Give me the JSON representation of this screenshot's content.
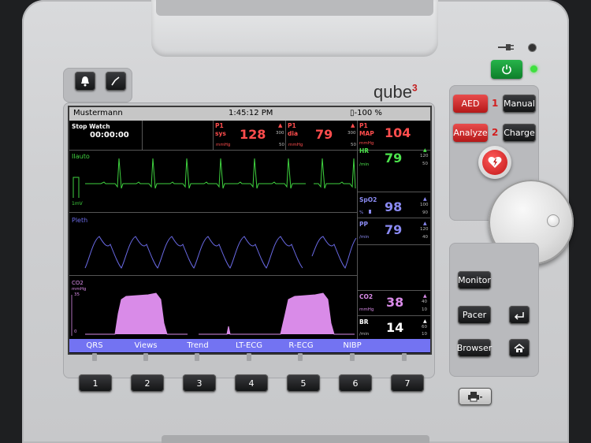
{
  "device": {
    "brand": "qube",
    "brand_sup": "3"
  },
  "screen": {
    "patient_name": "Mustermann",
    "clock": "1:45:12 PM",
    "battery": "-100 %",
    "stopwatch": {
      "label": "Stop Watch",
      "value": "00:00:00"
    },
    "nibp_sys": {
      "label": "P1",
      "sub": "sys",
      "value": "128",
      "upper": "300",
      "lower": "50",
      "unit": "mmHg"
    },
    "nibp_dia": {
      "label": "P1",
      "sub": "dia",
      "value": "79",
      "upper": "300",
      "lower": "50",
      "unit": "mmHg"
    },
    "nibp_map": {
      "label": "P1",
      "sub": "MAP",
      "value": "104",
      "unit": "mmHg"
    },
    "hr": {
      "label": "HR",
      "value": "79",
      "upper": "120",
      "lower": "50",
      "unit": "/min"
    },
    "spo2": {
      "label": "SpO2",
      "value": "98",
      "upper": "100",
      "lower": "90",
      "unit": "%"
    },
    "pp": {
      "label": "PP",
      "value": "79",
      "upper": "120",
      "lower": "40",
      "unit": "/min"
    },
    "co2": {
      "label": "CO2",
      "value": "38",
      "upper": "40",
      "lower": "10",
      "unit": "mmHg"
    },
    "br": {
      "label": "BR",
      "value": "14",
      "upper": "60",
      "lower": "10",
      "unit": "/min"
    },
    "ecg_label": "IIauto",
    "ecg_scale": "1mV",
    "pleth_label": "Pleth",
    "co2_wave_label": "CO2",
    "co2_wave_unit": "mmHg",
    "co2_scale_top": "35",
    "co2_scale_bottom": "0",
    "softkeys": [
      "QRS",
      "Views",
      "Trend",
      "LT-ECG",
      "R-ECG",
      "NIBP"
    ]
  },
  "hard_keys": [
    "1",
    "2",
    "3",
    "4",
    "5",
    "6",
    "7"
  ],
  "defib": {
    "aed_label": "AED",
    "aed_step": "1",
    "manual_label": "Manual",
    "analyze_label": "Analyze",
    "analyze_step": "2",
    "charge_label": "Charge"
  },
  "right_panel": {
    "monitor_label": "Monitor",
    "pacer_label": "Pacer",
    "browser_label": "Browser"
  },
  "colors": {
    "ecg": "#3fd23f",
    "pleth": "#6a6ae6",
    "co2": "#d98be8",
    "hr": "#4ce34c",
    "spo2": "#8a8af2",
    "nibp": "#ff4d4d",
    "softbar": "#7373f2",
    "power": "#1f9a3e"
  }
}
